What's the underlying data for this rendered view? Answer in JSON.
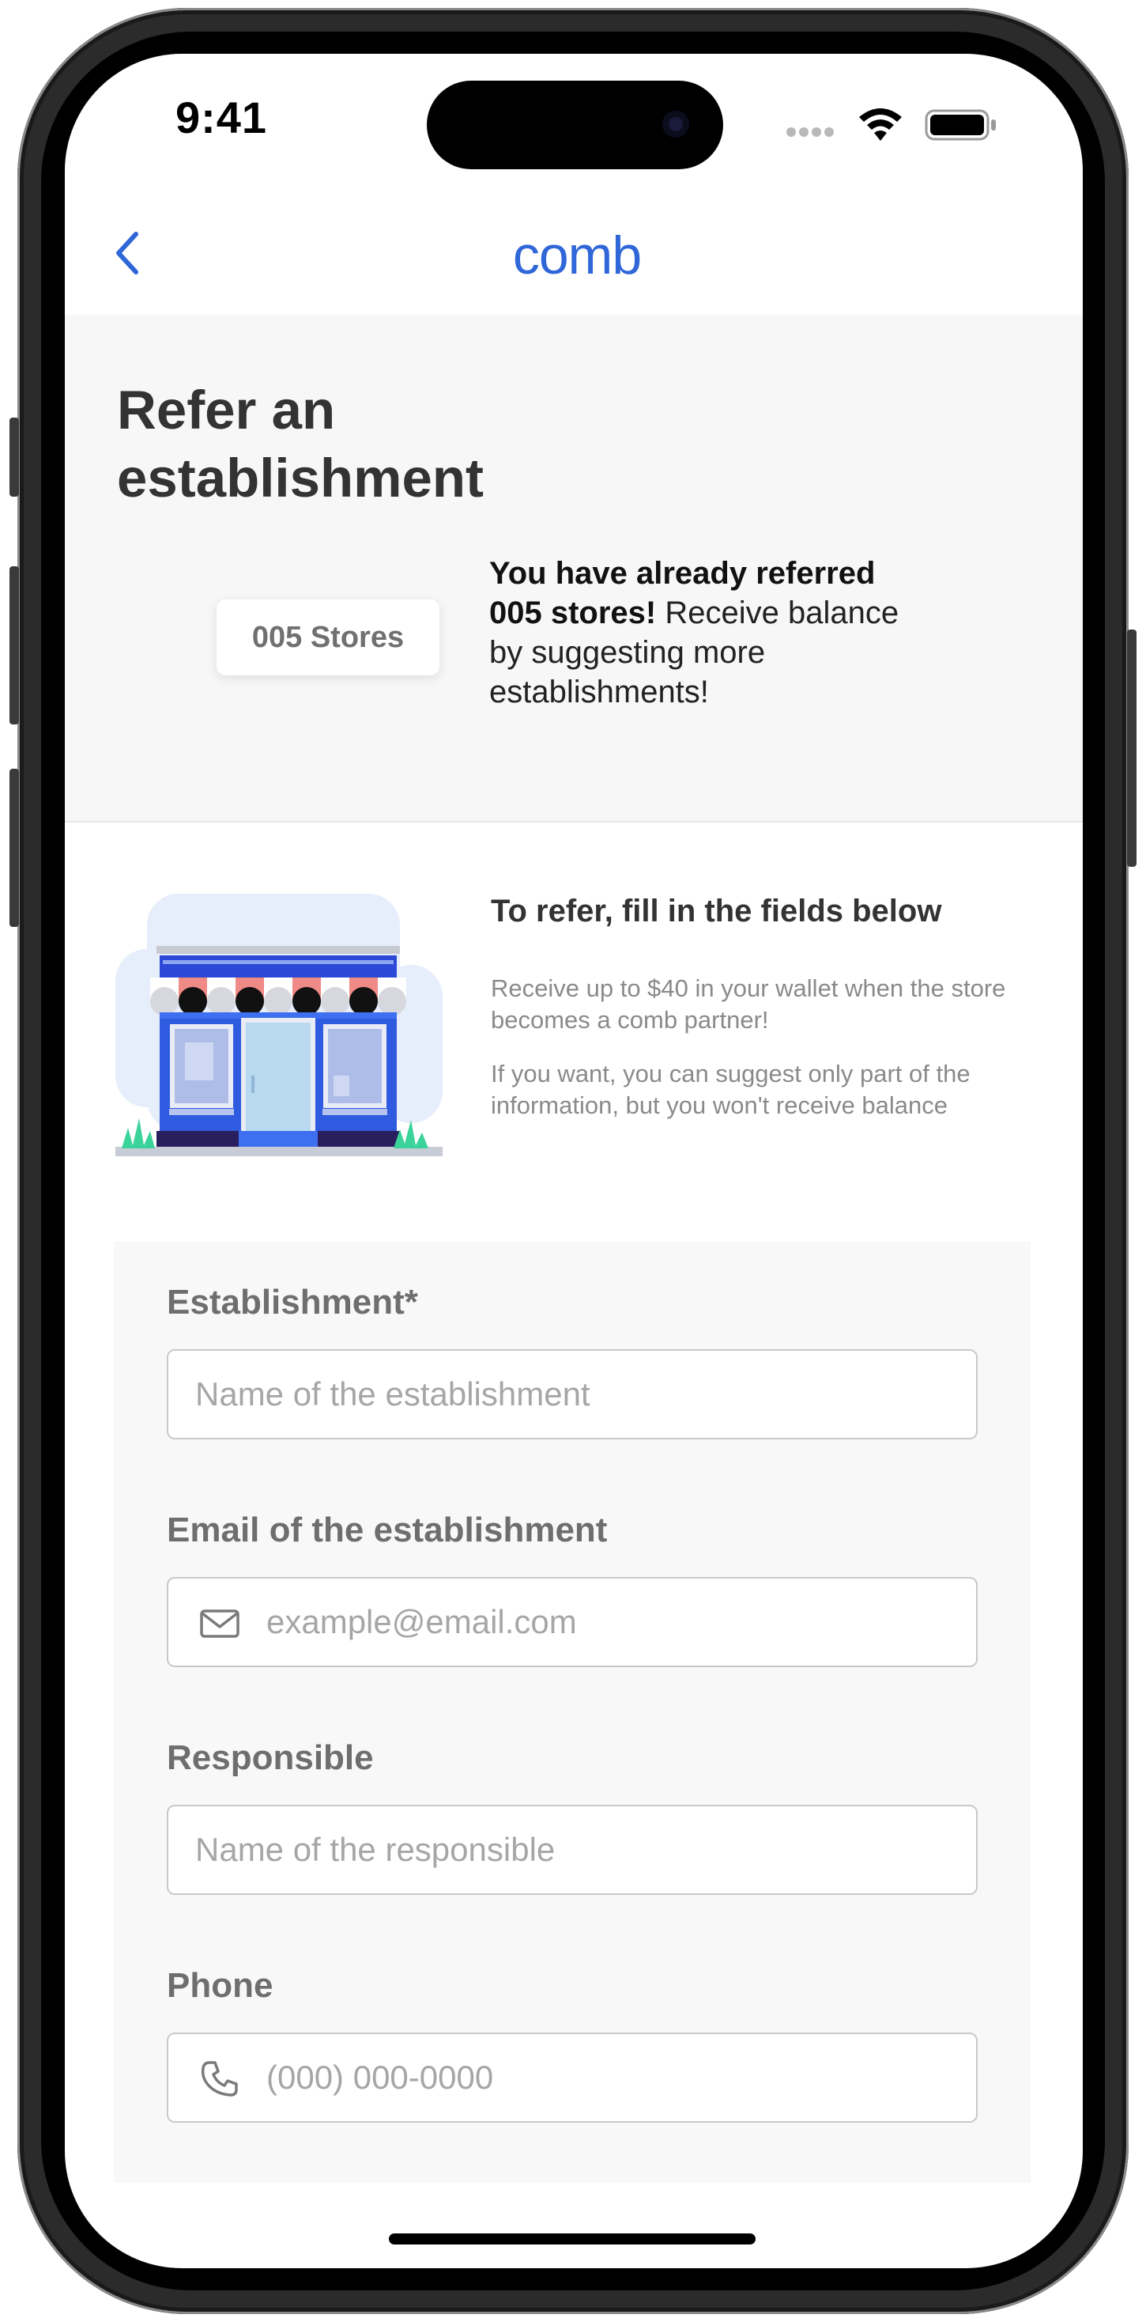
{
  "status_bar": {
    "time": "9:41"
  },
  "nav": {
    "back_label": "‹",
    "logo": "comb"
  },
  "header": {
    "title": "Refer an establishment",
    "stores_badge": "005 Stores",
    "referral_bold": "You have already referred 005 stores!",
    "referral_rest": " Receive balance by suggesting more establishments!"
  },
  "info": {
    "title": "To refer, fill in the fields below",
    "paragraph_1": "Receive up to $40 in your wallet when the store becomes a comb partner!",
    "paragraph_2": "If you want, you can suggest only part of the information, but you won't receive balance"
  },
  "form": {
    "establishment": {
      "label": "Establishment*",
      "placeholder": "Name of the establishment",
      "value": ""
    },
    "email": {
      "label": "Email of the establishment",
      "placeholder": "example@email.com",
      "value": "",
      "icon": "mail-icon"
    },
    "responsible": {
      "label": "Responsible",
      "placeholder": "Name of the responsible",
      "value": ""
    },
    "phone": {
      "label": "Phone",
      "placeholder": "(000) 000-0000",
      "value": "",
      "icon": "phone-icon"
    }
  },
  "colors": {
    "brand": "#2f67d8",
    "panel": "#f7f7f7",
    "text": "#333333",
    "muted": "#8a8a8a"
  }
}
